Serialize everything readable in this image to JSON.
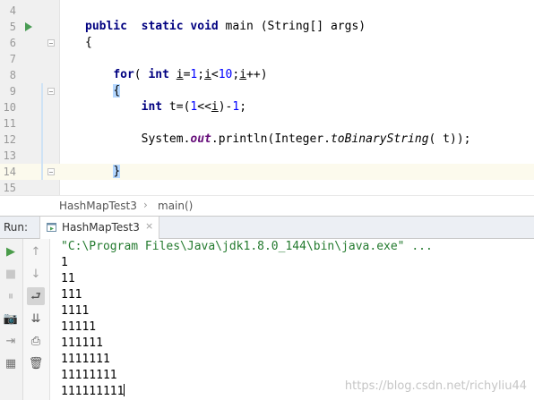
{
  "editor": {
    "lines": [
      {
        "num": "4"
      },
      {
        "num": "5",
        "parts": [
          {
            "t": "public",
            "c": "kw"
          },
          {
            "t": "  "
          },
          {
            "t": "static",
            "c": "kw"
          },
          {
            "t": " "
          },
          {
            "t": "void",
            "c": "kw"
          },
          {
            "t": " main (String[] args)"
          }
        ]
      },
      {
        "num": "6",
        "parts": [
          {
            "t": "{"
          }
        ]
      },
      {
        "num": "7"
      },
      {
        "num": "8",
        "parts": [
          {
            "t": "    "
          },
          {
            "t": "for",
            "c": "kw"
          },
          {
            "t": "( "
          },
          {
            "t": "int",
            "c": "kw"
          },
          {
            "t": " "
          },
          {
            "t": "i",
            "c": "und"
          },
          {
            "t": "="
          },
          {
            "t": "1",
            "c": "num"
          },
          {
            "t": ";"
          },
          {
            "t": "i",
            "c": "und"
          },
          {
            "t": "<"
          },
          {
            "t": "10",
            "c": "num"
          },
          {
            "t": ";"
          },
          {
            "t": "i",
            "c": "und"
          },
          {
            "t": "++)"
          }
        ]
      },
      {
        "num": "9",
        "parts": [
          {
            "t": "    "
          },
          {
            "t": "{",
            "c": "brace-hl"
          }
        ]
      },
      {
        "num": "10",
        "parts": [
          {
            "t": "        "
          },
          {
            "t": "int",
            "c": "kw"
          },
          {
            "t": " t=("
          },
          {
            "t": "1",
            "c": "num"
          },
          {
            "t": "<<"
          },
          {
            "t": "i",
            "c": "und"
          },
          {
            "t": ")-"
          },
          {
            "t": "1",
            "c": "num"
          },
          {
            "t": ";"
          }
        ]
      },
      {
        "num": "11"
      },
      {
        "num": "12",
        "parts": [
          {
            "t": "        System."
          },
          {
            "t": "out",
            "c": "fld"
          },
          {
            "t": ".println(Integer."
          },
          {
            "t": "toBinaryString",
            "c": "mth"
          },
          {
            "t": "( t));"
          }
        ]
      },
      {
        "num": "13"
      },
      {
        "num": "14",
        "parts": [
          {
            "t": "    "
          },
          {
            "t": "}",
            "c": "brace-hl"
          }
        ]
      },
      {
        "num": "15"
      }
    ]
  },
  "breadcrumb": {
    "file": "HashMapTest3",
    "separator": "›",
    "method": "main()"
  },
  "run": {
    "label": "Run:",
    "tab_label": "HashMapTest3",
    "tab_close": "×",
    "toolbar_left": [
      {
        "name": "rerun-icon",
        "glyph": "▶",
        "color": "#4a9c4a"
      },
      {
        "name": "stop-icon",
        "glyph": "■",
        "color": "#c8c8c8"
      },
      {
        "name": "pause-icon",
        "glyph": "⏸",
        "color": "#c0c0c0"
      },
      {
        "name": "camera-icon",
        "glyph": "📷",
        "color": "#b0b0b0"
      },
      {
        "name": "login-icon",
        "glyph": "⇥",
        "color": "#909090"
      },
      {
        "name": "layout-icon",
        "glyph": "▦",
        "color": "#707070"
      }
    ],
    "toolbar_right": [
      {
        "name": "up-arrow-icon",
        "glyph": "↑",
        "color": "#a0a0a0"
      },
      {
        "name": "down-arrow-icon",
        "glyph": "↓",
        "color": "#a0a0a0"
      },
      {
        "name": "soft-wrap-icon",
        "glyph": "⮐",
        "color": "#555555",
        "active": true
      },
      {
        "name": "scroll-to-end-icon",
        "glyph": "⇊",
        "color": "#555555"
      },
      {
        "name": "print-icon",
        "glyph": "⎙",
        "color": "#555555"
      },
      {
        "name": "trash-icon",
        "glyph": "🗑",
        "color": "#555555"
      }
    ]
  },
  "console": {
    "command": "\"C:\\Program Files\\Java\\jdk1.8.0_144\\bin\\java.exe\" ...",
    "output": [
      "1",
      "11",
      "111",
      "1111",
      "11111",
      "111111",
      "1111111",
      "11111111",
      "111111111"
    ]
  },
  "watermark": "https://blog.csdn.net/richyliu44",
  "colors": {
    "keyword": "#000080",
    "number": "#0000ff",
    "static_field": "#660e7a",
    "console_command": "#237a2e",
    "run_green": "#499c54"
  }
}
